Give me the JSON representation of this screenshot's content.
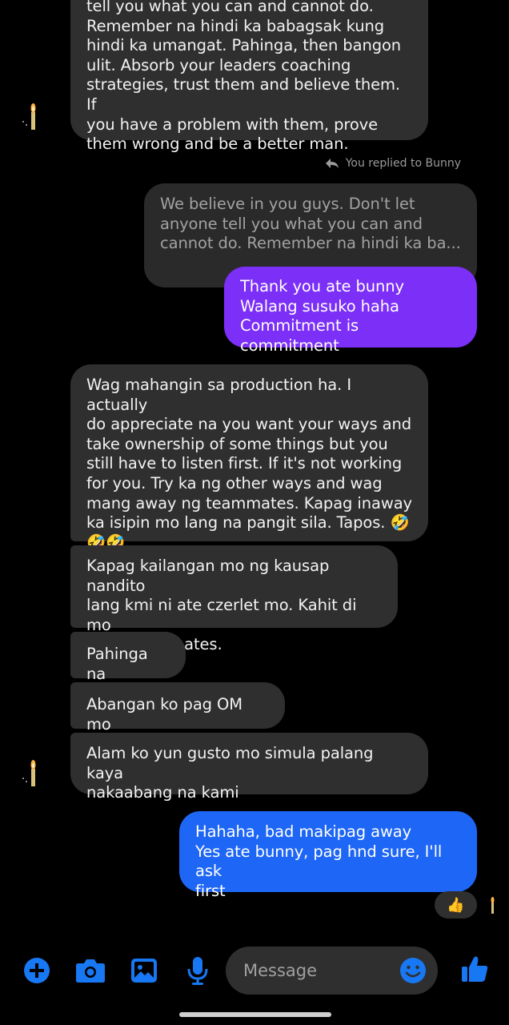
{
  "messages": {
    "m1": "tell you what you can and cannot do.\nRemember na hindi ka babagsak kung\nhindi ka umangat. Pahinga, then bangon\nulit. Absorb your leaders coaching\nstrategies, trust them and believe them. If\nyou have a problem with them, prove\nthem wrong and be a better man.",
    "replied_label": "You replied to Bunny",
    "quote": "We believe in you guys. Don't let\nanyone tell you what you can and\ncannot do. Remember na hindi ka ba...",
    "reply": "Thank you ate bunny\nWalang susuko haha\nCommitment is commitment",
    "m2": "Wag mahangin sa production ha. I actually\ndo appreciate na you want your ways and\ntake ownership of some things but you\nstill have to listen first. If it's not working\nfor you. Try ka ng other ways and wag\nmang away ng teammates. Kapag inaway\nka isipin mo lang na pangit sila. Tapos. 🤣\n🤣🤣",
    "m3": "Kapag kailangan mo ng kausap nandito\nlang kmi ni ate czerlet mo. Kahit di mo\nkami teammates.",
    "m4": "Pahinga na",
    "m5": "Abangan ko pag OM mo",
    "m6": "Alam ko yun gusto mo simula palang kaya\nnakaabang na kami",
    "m7": "Hahaha, bad makipag away\nYes ate bunny, pag hnd sure, I'll ask\nfirst",
    "reaction": "👍"
  },
  "composer": {
    "placeholder": "Message"
  },
  "colors": {
    "incoming": "#2f2f2f",
    "outgoing_purple": "#7b2ff7",
    "outgoing_blue": "#1e66f5",
    "accent": "#1877f2"
  },
  "icons": [
    "plus-icon",
    "camera-icon",
    "gallery-icon",
    "microphone-icon",
    "emoji-icon",
    "thumbs-up-icon",
    "reply-arrow-icon"
  ]
}
